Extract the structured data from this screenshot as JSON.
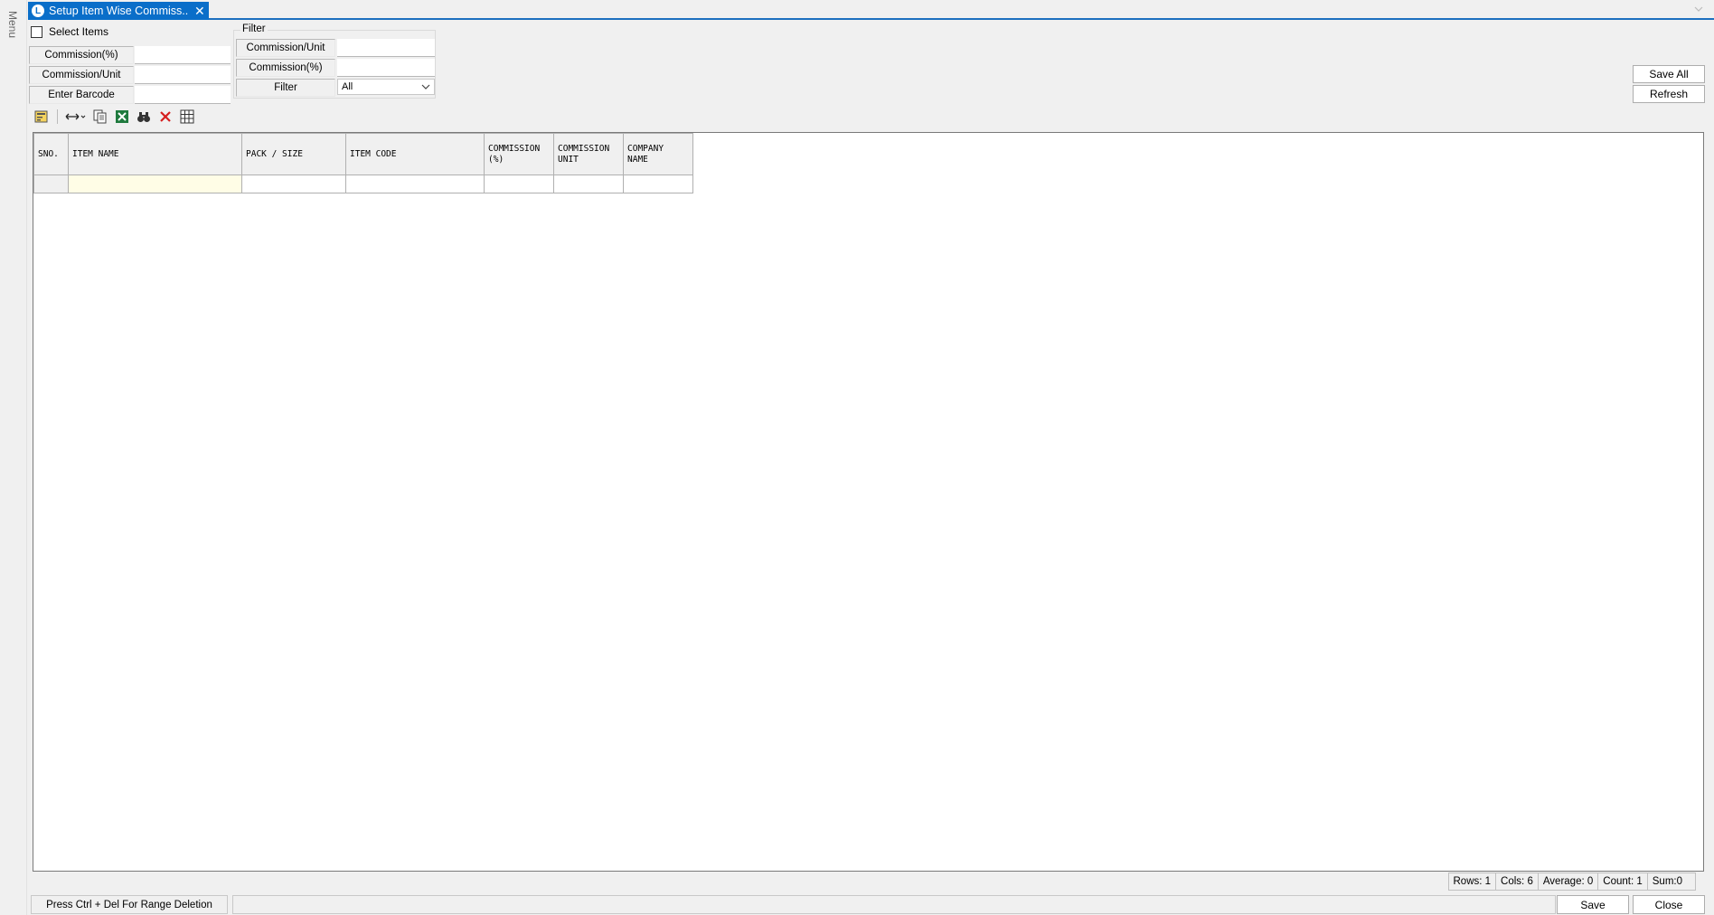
{
  "side_menu": {
    "label": "Menu"
  },
  "tab": {
    "title": "Setup Item Wise Commiss...",
    "close": "✕",
    "icon_letter": "L"
  },
  "select_items": {
    "label": "Select Items",
    "checked": false
  },
  "left_fields": [
    {
      "label": "Commission(%)",
      "value": ""
    },
    {
      "label": "Commission/Unit",
      "value": ""
    },
    {
      "label": "Enter Barcode",
      "value": ""
    }
  ],
  "filter": {
    "title": "Filter",
    "fields": [
      {
        "label": "Commission/Unit",
        "value": ""
      },
      {
        "label": "Commission(%)",
        "value": ""
      }
    ],
    "filter_label": "Filter",
    "filter_value": "All"
  },
  "actions": {
    "save_all": "Save All",
    "refresh": "Refresh"
  },
  "toolbar_icons": [
    "form-icon",
    "column-resize-icon",
    "copy-icon",
    "excel-export-icon",
    "find-icon",
    "delete-icon",
    "grid-icon"
  ],
  "grid": {
    "columns": [
      "SNO.",
      "ITEM NAME",
      "PACK / SIZE",
      "ITEM CODE",
      "COMMISSION (%)",
      "COMMISSION UNIT",
      "COMPANY NAME"
    ],
    "rows": [
      [
        "",
        "",
        "",
        "",
        "",
        "",
        ""
      ]
    ]
  },
  "status": {
    "rows": "Rows: 1",
    "cols": "Cols: 6",
    "average": "Average: 0",
    "count": "Count: 1",
    "sum": "Sum:0"
  },
  "bottom": {
    "hint": "Press Ctrl + Del For Range Deletion",
    "save": "Save",
    "close": "Close"
  }
}
